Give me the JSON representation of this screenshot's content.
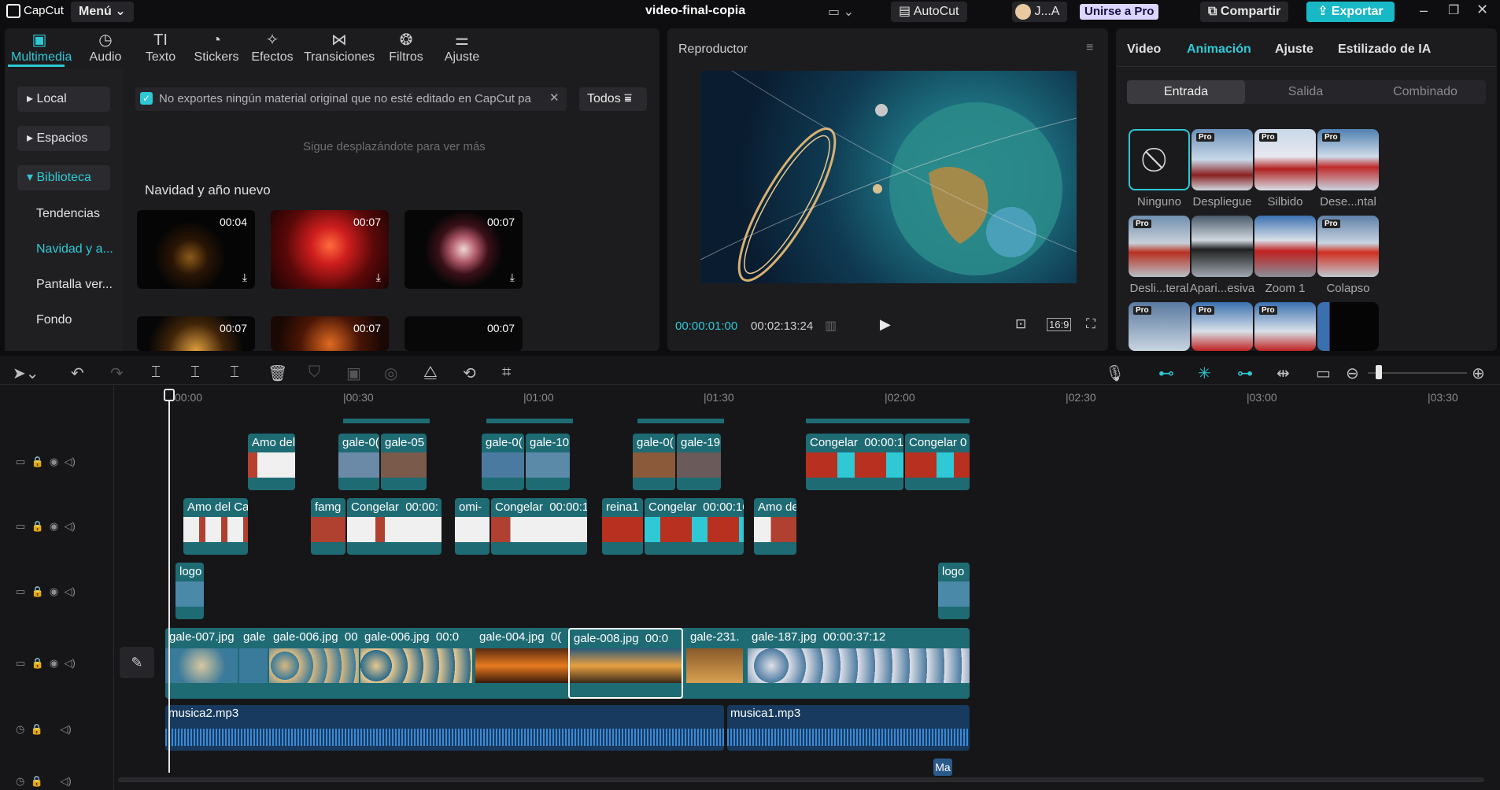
{
  "titlebar": {
    "logo": "CapCut",
    "menu": "Menú",
    "project": "video-final-copia",
    "autocut": "AutoCut",
    "user": "J...A",
    "join_pro": "Unirse a Pro",
    "share": "Compartir",
    "export": "Exportar"
  },
  "toolbar": {
    "items": [
      {
        "label": "Multimedia",
        "icon": "media-icon"
      },
      {
        "label": "Audio",
        "icon": "audio-icon"
      },
      {
        "label": "Texto",
        "icon": "text-icon"
      },
      {
        "label": "Stickers",
        "icon": "sticker-icon"
      },
      {
        "label": "Efectos",
        "icon": "effects-icon"
      },
      {
        "label": "Transiciones",
        "icon": "transition-icon"
      },
      {
        "label": "Filtros",
        "icon": "filter-icon"
      },
      {
        "label": "Ajuste",
        "icon": "adjust-icon"
      }
    ]
  },
  "sidebar": {
    "items": [
      "Local",
      "Espacios",
      "Biblioteca",
      "Tendencias",
      "Navidad y a...",
      "Pantalla ver...",
      "Fondo"
    ]
  },
  "media": {
    "notice": "No exportes ningún material original que no esté editado en CapCut pa",
    "filter": "Todos",
    "scroll_hint": "Sigue desplazándote para ver más",
    "section": "Navidad y año nuevo",
    "durations": [
      "00:04",
      "00:07",
      "00:07",
      "00:07",
      "00:07",
      "00:07"
    ]
  },
  "player": {
    "title": "Reproductor",
    "current": "00:00:01:00",
    "total": "00:02:13:24",
    "ratio": "16:9"
  },
  "inspector": {
    "tabs": [
      "Video",
      "Animación",
      "Ajuste",
      "Estilizado de IA"
    ],
    "subtabs": [
      "Entrada",
      "Salida",
      "Combinado"
    ],
    "pro_badge": "Pro",
    "items": [
      "Ninguno",
      "Despliegue",
      "Silbido",
      "Dese...ntal",
      "Desli...teral",
      "Apari...esiva",
      "Zoom 1",
      "Colapso"
    ]
  },
  "timeline": {
    "ticks": [
      "00:00",
      "|00:30",
      "|01:00",
      "|01:30",
      "|02:00",
      "|02:30",
      "|03:00",
      "|03:30"
    ],
    "track1": [
      "Amo del",
      "gale-0(",
      "gale-05",
      "gale-0(",
      "gale-10",
      "gale-0(",
      "gale-19",
      "Congelar",
      "00:00:1",
      "Congelar",
      "0"
    ],
    "track2": [
      "Amo del Ca",
      "famg",
      "Congelar",
      "00:00:",
      "omi-",
      "Congelar",
      "00:00:1",
      "reina1",
      "Congelar",
      "00:00:16",
      "Amo de"
    ],
    "track3": [
      "logo",
      "logo"
    ],
    "main": [
      "gale-007.jpg",
      "gale",
      "gale-006.jpg",
      "00",
      "gale-006.jpg",
      "00:0",
      "gale-004.jpg",
      "0(",
      "gale-008.jpg",
      "00:0",
      "gale-231.",
      "gale-187.jpg",
      "00:00:37:12"
    ],
    "audio": [
      "musica2.mp3",
      "musica1.mp3"
    ],
    "marker": "Ma"
  }
}
